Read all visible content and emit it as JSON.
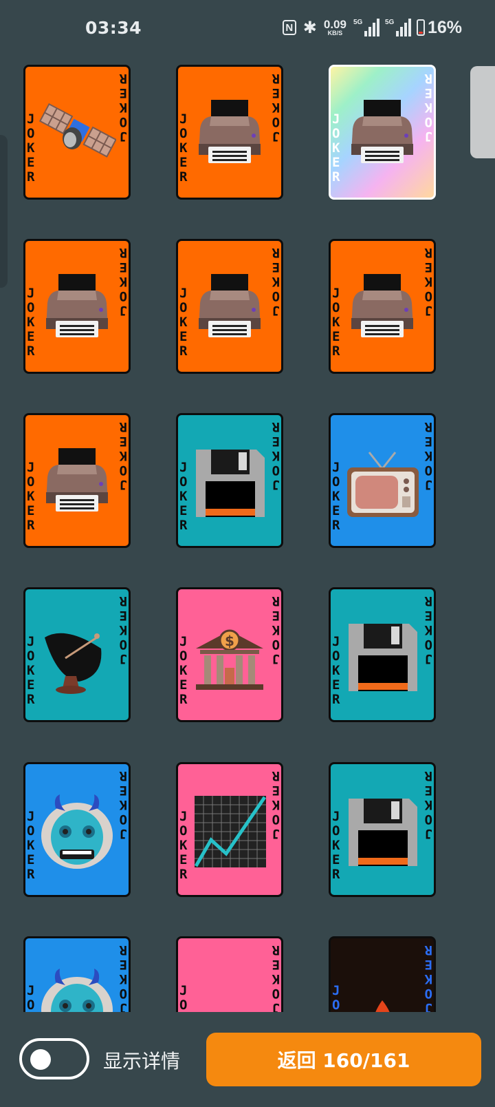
{
  "status_bar": {
    "time": "03:34",
    "net_speed_value": "0.09",
    "net_speed_unit": "KB/S",
    "sim1_label": "5G",
    "sim2_label": "5G",
    "battery_percent": "16%",
    "battery_level": 0.16,
    "icons": [
      "nfc-icon",
      "bluetooth-icon",
      "signal-icon",
      "signal-icon",
      "battery-icon"
    ]
  },
  "colors": {
    "background": "#37474c",
    "orange": "#ff6a00",
    "teal": "#13a8b4",
    "blue": "#1f8fe9",
    "pink": "#ff6196",
    "button": "#f5890f"
  },
  "cards": [
    {
      "label": "JOKER",
      "bg": "orange",
      "icon": "satellite-icon"
    },
    {
      "label": "JOKER",
      "bg": "orange",
      "icon": "printer-icon"
    },
    {
      "label": "JOKER",
      "bg": "holo",
      "icon": "printer-icon"
    },
    {
      "label": "JOKER",
      "bg": "orange",
      "icon": "printer-icon"
    },
    {
      "label": "JOKER",
      "bg": "orange",
      "icon": "printer-icon"
    },
    {
      "label": "JOKER",
      "bg": "orange",
      "icon": "printer-icon"
    },
    {
      "label": "JOKER",
      "bg": "orange",
      "icon": "printer-icon"
    },
    {
      "label": "JOKER",
      "bg": "teal",
      "icon": "floppy-disk-icon"
    },
    {
      "label": "JOKER",
      "bg": "blue",
      "icon": "television-icon"
    },
    {
      "label": "JOKER",
      "bg": "teal",
      "icon": "satellite-dish-icon"
    },
    {
      "label": "JOKER",
      "bg": "pink",
      "icon": "bank-icon"
    },
    {
      "label": "JOKER",
      "bg": "teal",
      "icon": "floppy-disk-icon"
    },
    {
      "label": "JOKER",
      "bg": "blue",
      "icon": "ogre-mask-icon"
    },
    {
      "label": "JOKER",
      "bg": "pink",
      "icon": "chart-increasing-icon"
    },
    {
      "label": "JOKER",
      "bg": "teal",
      "icon": "floppy-disk-icon"
    },
    {
      "label": "JOKER",
      "bg": "blue",
      "icon": "ogre-mask-icon"
    },
    {
      "label": "JOKER",
      "bg": "pink",
      "icon": "egg-icon"
    },
    {
      "label": "JOKER",
      "bg": "dark",
      "icon": "fire-icon"
    }
  ],
  "footer": {
    "toggle_label": "显示详情",
    "toggle_on": false,
    "back_button_label": "返回 160/161"
  }
}
